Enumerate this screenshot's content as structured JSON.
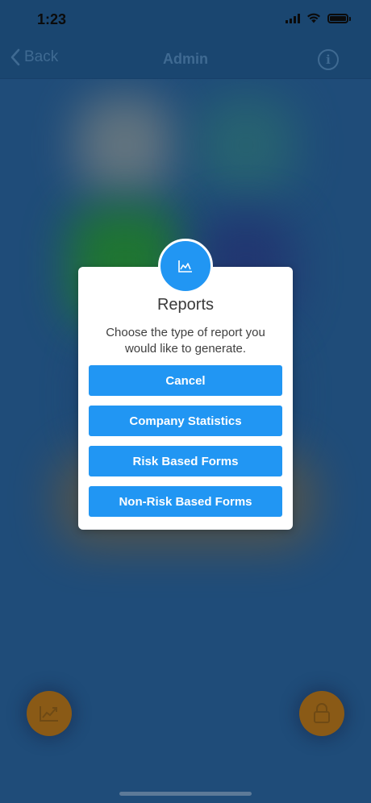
{
  "status_bar": {
    "time": "1:23"
  },
  "nav": {
    "back_label": "Back",
    "title": "Admin"
  },
  "dialog": {
    "title": "Reports",
    "message": "Choose the type of report you would like to generate.",
    "buttons": [
      "Cancel",
      "Company Statistics",
      "Risk Based Forms",
      "Non-Risk Based Forms"
    ]
  },
  "icons": {
    "status": [
      "signal-icon",
      "wifi-icon",
      "battery-icon"
    ],
    "nav": [
      "chevron-left-icon",
      "info-icon"
    ],
    "dialog_badge": "chart-icon",
    "fab_left": "chart-icon",
    "fab_right": "lock-icon"
  },
  "colors": {
    "accent": "#2196f3",
    "fab": "#8a5a16",
    "overlay": "#1f4c79"
  }
}
